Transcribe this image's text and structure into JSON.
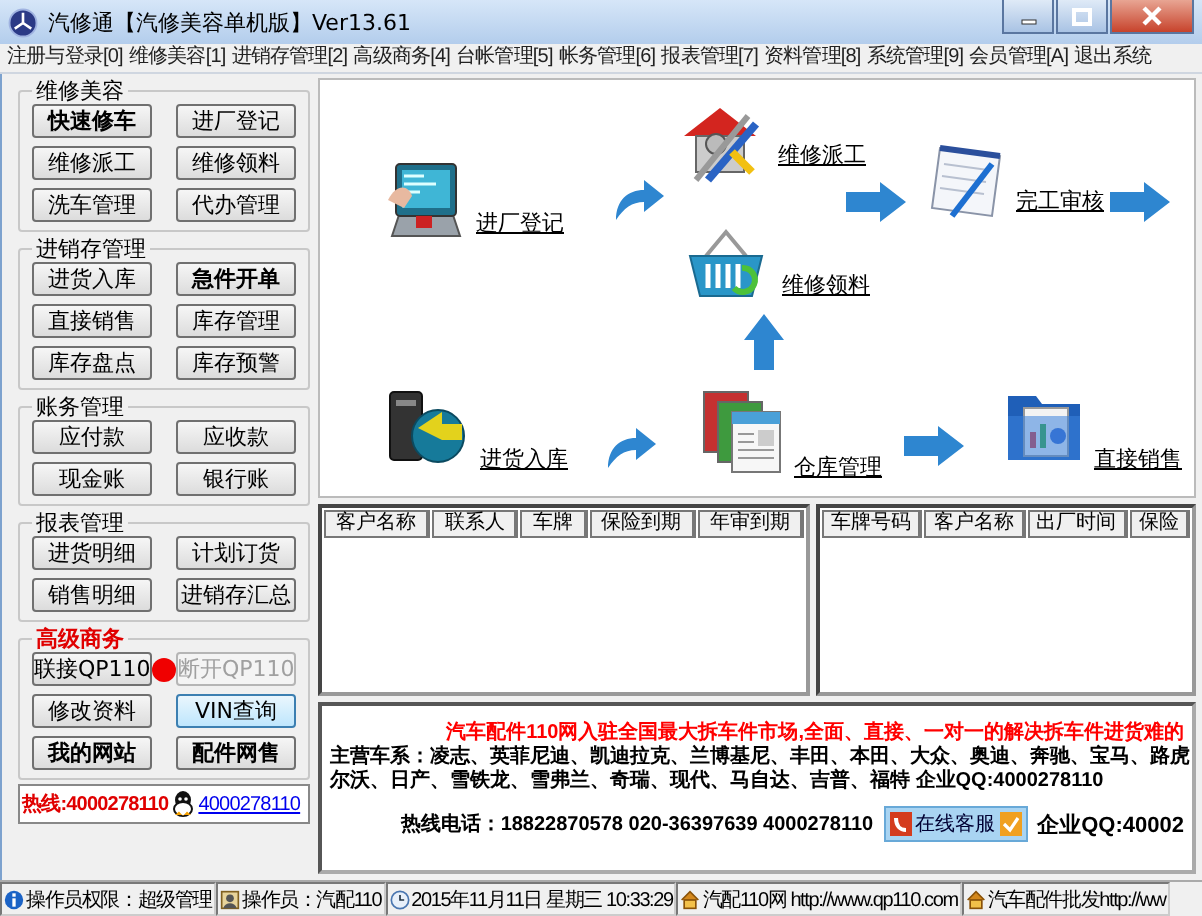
{
  "window": {
    "title": "汽修通【汽修美容单机版】Ver13.61"
  },
  "menu": [
    "注册与登录[0]",
    "维修美容[1]",
    "进销存管理[2]",
    "高级商务[4]",
    "台帐管理[5]",
    "帐务管理[6]",
    "报表管理[7]",
    "资料管理[8]",
    "系统管理[9]",
    "会员管理[A]",
    "退出系统"
  ],
  "sidebar": {
    "groups": [
      {
        "title": "维修美容",
        "highlight": false,
        "buttons": [
          {
            "label": "快速修车",
            "bold": true
          },
          {
            "label": "进厂登记",
            "bold": false
          },
          {
            "label": "维修派工",
            "bold": false
          },
          {
            "label": "维修领料",
            "bold": false
          },
          {
            "label": "洗车管理",
            "bold": false
          },
          {
            "label": "代办管理",
            "bold": false
          }
        ]
      },
      {
        "title": "进销存管理",
        "highlight": false,
        "buttons": [
          {
            "label": "进货入库",
            "bold": false
          },
          {
            "label": "急件开单",
            "bold": true
          },
          {
            "label": "直接销售",
            "bold": false
          },
          {
            "label": "库存管理",
            "bold": false
          },
          {
            "label": "库存盘点",
            "bold": false
          },
          {
            "label": "库存预警",
            "bold": false
          }
        ]
      },
      {
        "title": "账务管理",
        "highlight": false,
        "buttons": [
          {
            "label": "应付款",
            "bold": false
          },
          {
            "label": "应收款",
            "bold": false
          },
          {
            "label": "现金账",
            "bold": false
          },
          {
            "label": "银行账",
            "bold": false
          }
        ]
      },
      {
        "title": "报表管理",
        "highlight": false,
        "buttons": [
          {
            "label": "进货明细",
            "bold": false
          },
          {
            "label": "计划订货",
            "bold": false
          },
          {
            "label": "销售明细",
            "bold": false
          },
          {
            "label": "进销存汇总",
            "bold": false
          }
        ]
      },
      {
        "title": "高级商务",
        "highlight": true,
        "buttons": [
          {
            "kind": "button",
            "label": "联接QP110",
            "bold": false,
            "disabled": false,
            "focused": false
          },
          {
            "kind": "light",
            "on": false
          },
          {
            "kind": "button",
            "label": "断开QP110",
            "bold": false,
            "disabled": true,
            "focused": false
          },
          {
            "kind": "button",
            "label": "修改资料",
            "bold": false,
            "disabled": false,
            "focused": false
          },
          {
            "kind": "button",
            "label": "VIN查询",
            "bold": false,
            "disabled": false,
            "focused": true
          },
          {
            "kind": "button",
            "label": "我的网站",
            "bold": true,
            "disabled": false,
            "focused": false
          },
          {
            "kind": "button",
            "label": "配件网售",
            "bold": true,
            "disabled": false,
            "focused": false
          }
        ]
      }
    ],
    "hotline": {
      "label": "热线:4000278110",
      "qq_link": "4000278110"
    }
  },
  "flow": {
    "nodes": [
      {
        "kind": "register",
        "label": "进厂登记"
      },
      {
        "kind": "dispatch",
        "label": "维修派工"
      },
      {
        "kind": "review",
        "label": "完工审核"
      },
      {
        "kind": "materials",
        "label": "维修领料"
      },
      {
        "kind": "stock_in",
        "label": "进货入库"
      },
      {
        "kind": "warehouse",
        "label": "仓库管理"
      },
      {
        "kind": "sale",
        "label": "直接销售"
      }
    ]
  },
  "tables": [
    {
      "columns": [
        "客户名称",
        "联系人",
        "车牌",
        "保险到期",
        "年审到期"
      ]
    },
    {
      "columns": [
        "车牌号码",
        "客户名称",
        "出厂时间",
        "保险"
      ]
    }
  ],
  "ad": {
    "headline": "汽车配件110网入驻全国最大拆车件市场,全面、直接、一对一的解决拆车件进货难的",
    "brands": [
      "主营车系：凌志、英菲尼迪、凯迪拉克、兰博基尼、丰田、本田、大众、奥迪、奔驰、宝马、路虎",
      "尔沃、日产、雪铁龙、雪弗兰、奇瑞、现代、马自达、吉普、福特 企业QQ:4000278110"
    ],
    "hotline": "热线电话：18822870578 020-36397639 4000278110",
    "service_badge": "在线客服",
    "qq": "企业QQ:40002"
  },
  "status_bar": [
    {
      "kind": "info",
      "text": "操作员权限：超级管理"
    },
    {
      "kind": "user",
      "text": "操作员：汽配110"
    },
    {
      "kind": "clock",
      "text": "2015年11月11日 星期三 10:33:29"
    },
    {
      "kind": "home",
      "text": "汽配110网 http://www.qp110.com"
    },
    {
      "kind": "home",
      "text": "汽车配件批发http://ww"
    }
  ]
}
